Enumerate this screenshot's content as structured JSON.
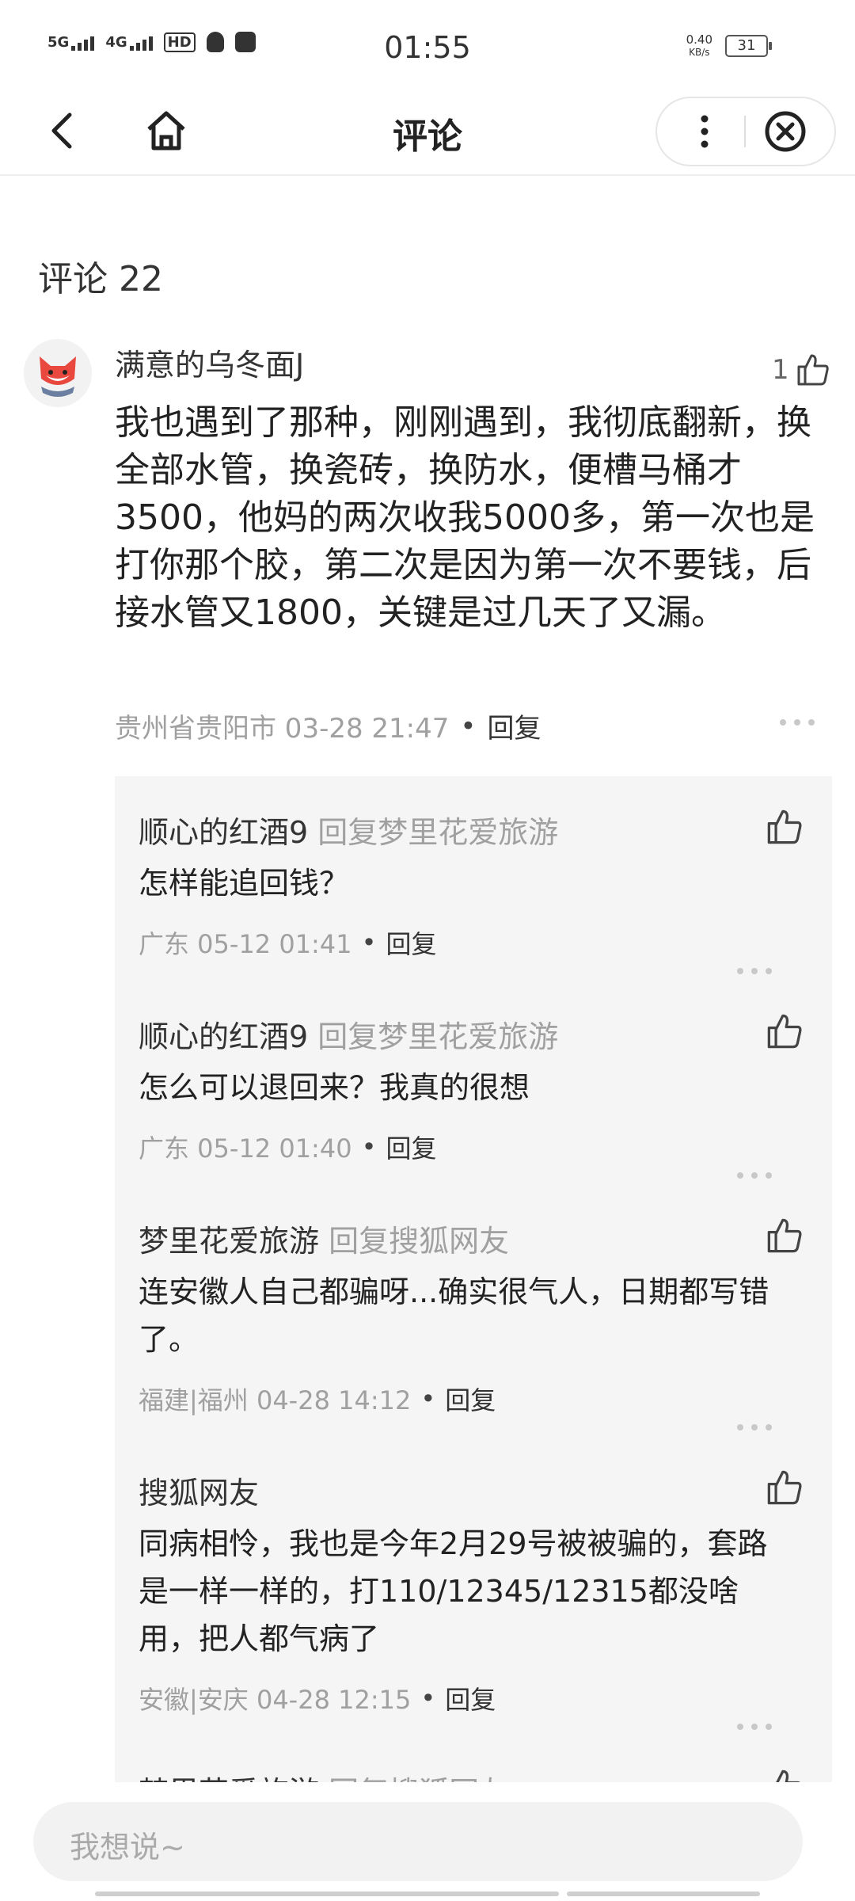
{
  "status_bar": {
    "signal1": "5G",
    "signal2": "4G",
    "hd": "HD",
    "time": "01:55",
    "speed_value": "0.40",
    "speed_unit": "KB/s",
    "battery": "31"
  },
  "nav": {
    "title": "评论"
  },
  "comment_count_label": "评论 22",
  "main_comment": {
    "username": "满意的乌冬面J",
    "like_count": "1",
    "text": "我也遇到了那种，刚刚遇到，我彻底翻新，换全部水管，换瓷砖，换防水，便槽马桶才3500，他妈的两次收我5000多，第一次也是打你那个胶，第二次是因为第一次不要钱，后接水管又1800，关键是过几天了又漏。",
    "location_time": "贵州省贵阳市 03-28 21:47",
    "reply_label": "回复"
  },
  "replies": [
    {
      "user": "顺心的红酒9",
      "reply_to": "回复梦里花爱旅游",
      "text": "怎样能追回钱？",
      "meta": "广东 05-12 01:41",
      "reply_label": "回复"
    },
    {
      "user": "顺心的红酒9",
      "reply_to": "回复梦里花爱旅游",
      "text": "怎么可以退回来？我真的很想",
      "meta": "广东 05-12 01:40",
      "reply_label": "回复"
    },
    {
      "user": "梦里花爱旅游",
      "reply_to": "回复搜狐网友",
      "text": "连安徽人自己都骗呀...确实很气人，日期都写错了。",
      "meta": "福建|福州 04-28 14:12",
      "reply_label": "回复"
    },
    {
      "user": "搜狐网友",
      "reply_to": "",
      "text": "同病相怜，我也是今年2月29号被被骗的，套路是一样一样的，打110/12345/12315都没啥用，把人都气病了",
      "meta": "安徽|安庆 04-28 12:15",
      "reply_label": "回复"
    },
    {
      "user": "梦里花爱旅游",
      "reply_to": "回复搜狐网友",
      "text": "",
      "meta": "",
      "reply_label": ""
    }
  ],
  "input": {
    "placeholder": "我想说~"
  }
}
